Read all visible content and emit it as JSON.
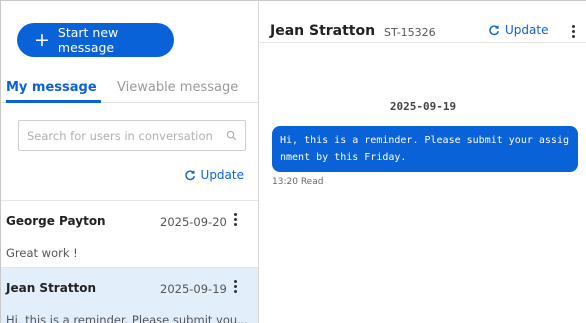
{
  "sidebar": {
    "new_message_label": "Start new message",
    "tabs": [
      {
        "label": "My message",
        "active": true
      },
      {
        "label": "Viewable message",
        "active": false
      }
    ],
    "search_placeholder": "Search for users in conversation",
    "update_label": "Update",
    "conversations": [
      {
        "name": "George Payton",
        "date": "2025-09-20",
        "preview": "Great work !",
        "selected": false
      },
      {
        "name": "Jean Stratton",
        "date": "2025-09-19",
        "preview": "Hi, this is a reminder. Please submit you...",
        "selected": true
      }
    ]
  },
  "header": {
    "name": "Jean Stratton",
    "id": "ST-15326",
    "update_label": "Update"
  },
  "chat": {
    "day": "2025-09-19",
    "messages": [
      {
        "text": "Hi, this is a reminder. Please submit your assignment by this Friday.",
        "time": "13:20",
        "status": "Read"
      }
    ]
  },
  "colors": {
    "accent": "#0a62d8",
    "selected_row": "#e3eefb"
  },
  "icons": [
    "plus-icon",
    "search-icon",
    "refresh-icon",
    "more-vertical-icon"
  ]
}
